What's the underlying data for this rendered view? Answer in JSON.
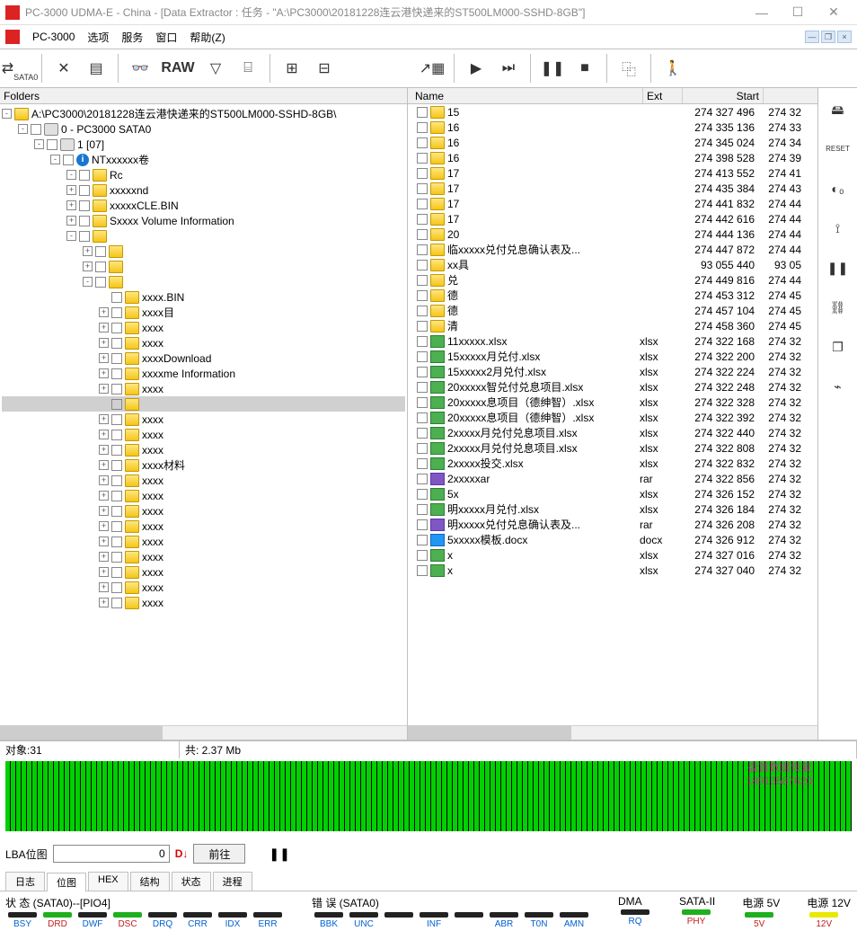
{
  "window": {
    "title": "PC-3000 UDMA-E - China - [Data Extractor : 任务 - \"A:\\PC3000\\20181228连云港快递来的ST500LM000-SSHD-8GB\"]"
  },
  "menubar": {
    "app": "PC-3000",
    "items": [
      "选项",
      "服务",
      "窗口",
      "帮助(Z)"
    ]
  },
  "toolbar": {
    "sata_label": "SATA0",
    "raw": "RAW"
  },
  "right_toolbar": {
    "reset": "RESET"
  },
  "left": {
    "header": "Folders",
    "root": "A:\\PC3000\\20181228连云港快递来的ST500LM000-SSHD-8GB\\",
    "node0": "0 - PC3000 SATA0",
    "node1": "1 [07]",
    "nt": "NTxxxxxx卷",
    "items": [
      {
        "t": "Rc",
        "exp": "-",
        "sel": true
      },
      {
        "t": "xxxxxnd",
        "exp": "+"
      },
      {
        "t": "xxxxxCLE.BIN",
        "exp": "+"
      },
      {
        "t": "Sxxxx Volume Information",
        "exp": "+"
      },
      {
        "t": "",
        "exp": "-"
      },
      {
        "t": "",
        "exp": "+",
        "ind": 1
      },
      {
        "t": "",
        "exp": "+",
        "ind": 1
      },
      {
        "t": "",
        "exp": "-",
        "ind": 1
      },
      {
        "t": "xxxx.BIN",
        "exp": "",
        "ind": 2
      },
      {
        "t": "xxxx目",
        "exp": "+",
        "ind": 2
      },
      {
        "t": "xxxx",
        "exp": "+",
        "ind": 2
      },
      {
        "t": "xxxx",
        "exp": "+",
        "ind": 2
      },
      {
        "t": "xxxxDownload",
        "exp": "+",
        "ind": 2
      },
      {
        "t": "xxxxme Information",
        "exp": "+",
        "ind": 2
      },
      {
        "t": "xxxx",
        "exp": "+",
        "ind": 2
      },
      {
        "t": "",
        "exp": "",
        "ind": 2,
        "hl": true
      },
      {
        "t": "xxxx",
        "exp": "+",
        "ind": 2
      },
      {
        "t": "xxxx",
        "exp": "+",
        "ind": 2
      },
      {
        "t": "xxxx",
        "exp": "+",
        "ind": 2
      },
      {
        "t": "xxxx材料",
        "exp": "+",
        "ind": 2
      },
      {
        "t": "xxxx",
        "exp": "+",
        "ind": 2
      },
      {
        "t": "xxxx",
        "exp": "+",
        "ind": 2
      },
      {
        "t": "xxxx",
        "exp": "+",
        "ind": 2
      },
      {
        "t": "xxxx",
        "exp": "+",
        "ind": 2
      },
      {
        "t": "xxxx",
        "exp": "+",
        "ind": 2
      },
      {
        "t": "xxxx",
        "exp": "+",
        "ind": 2
      },
      {
        "t": "xxxx",
        "exp": "+",
        "ind": 2
      },
      {
        "t": "xxxx",
        "exp": "+",
        "ind": 2
      },
      {
        "t": "xxxx",
        "exp": "+",
        "ind": 2
      }
    ]
  },
  "right": {
    "cols": {
      "name": "Name",
      "ext": "Ext",
      "start": "Start"
    },
    "rows": [
      {
        "icon": "f",
        "n": "15",
        "ext": "",
        "s": "274 327 496",
        "e": "274 32"
      },
      {
        "icon": "f",
        "n": "16",
        "ext": "",
        "s": "274 335 136",
        "e": "274 33"
      },
      {
        "icon": "f",
        "n": "16",
        "ext": "",
        "s": "274 345 024",
        "e": "274 34"
      },
      {
        "icon": "f",
        "n": "16",
        "ext": "",
        "s": "274 398 528",
        "e": "274 39"
      },
      {
        "icon": "f",
        "n": "17",
        "ext": "",
        "s": "274 413 552",
        "e": "274 41"
      },
      {
        "icon": "f",
        "n": "17",
        "ext": "",
        "s": "274 435 384",
        "e": "274 43"
      },
      {
        "icon": "f",
        "n": "17",
        "ext": "",
        "s": "274 441 832",
        "e": "274 44"
      },
      {
        "icon": "f",
        "n": "17",
        "ext": "",
        "s": "274 442 616",
        "e": "274 44"
      },
      {
        "icon": "f",
        "n": "20",
        "ext": "",
        "s": "274 444 136",
        "e": "274 44"
      },
      {
        "icon": "f",
        "n": "临xxxxx兑付兑息确认表及...",
        "ext": "",
        "s": "274 447 872",
        "e": "274 44"
      },
      {
        "icon": "f",
        "n": "xx具",
        "ext": "",
        "s": "93 055 440",
        "e": "93 05"
      },
      {
        "icon": "f",
        "n": "兑",
        "ext": "",
        "s": "274 449 816",
        "e": "274 44"
      },
      {
        "icon": "f",
        "n": "德",
        "ext": "",
        "s": "274 453 312",
        "e": "274 45"
      },
      {
        "icon": "f",
        "n": "德",
        "ext": "",
        "s": "274 457 104",
        "e": "274 45"
      },
      {
        "icon": "f",
        "n": "清",
        "ext": "",
        "s": "274 458 360",
        "e": "274 45"
      },
      {
        "icon": "x",
        "n": "11xxxxx.xlsx",
        "ext": "xlsx",
        "s": "274 322 168",
        "e": "274 32"
      },
      {
        "icon": "x",
        "n": "15xxxxx月兑付.xlsx",
        "ext": "xlsx",
        "s": "274 322 200",
        "e": "274 32"
      },
      {
        "icon": "x",
        "n": "15xxxxx2月兑付.xlsx",
        "ext": "xlsx",
        "s": "274 322 224",
        "e": "274 32"
      },
      {
        "icon": "x",
        "n": "20xxxxx智兑付兑息项目.xlsx",
        "ext": "xlsx",
        "s": "274 322 248",
        "e": "274 32"
      },
      {
        "icon": "x",
        "n": "20xxxxx息项目（德绅智）.xlsx",
        "ext": "xlsx",
        "s": "274 322 328",
        "e": "274 32"
      },
      {
        "icon": "x",
        "n": "20xxxxx息项目（德绅智）.xlsx",
        "ext": "xlsx",
        "s": "274 322 392",
        "e": "274 32"
      },
      {
        "icon": "x",
        "n": "2xxxxx月兑付兑息项目.xlsx",
        "ext": "xlsx",
        "s": "274 322 440",
        "e": "274 32"
      },
      {
        "icon": "x",
        "n": "2xxxxx月兑付兑息项目.xlsx",
        "ext": "xlsx",
        "s": "274 322 808",
        "e": "274 32"
      },
      {
        "icon": "x",
        "n": "2xxxxx投交.xlsx",
        "ext": "xlsx",
        "s": "274 322 832",
        "e": "274 32"
      },
      {
        "icon": "r",
        "n": "2xxxxxar",
        "ext": "rar",
        "s": "274 322 856",
        "e": "274 32"
      },
      {
        "icon": "x",
        "n": "5x",
        "ext": "xlsx",
        "s": "274 326 152",
        "e": "274 32"
      },
      {
        "icon": "x",
        "n": "明xxxxx月兑付.xlsx",
        "ext": "xlsx",
        "s": "274 326 184",
        "e": "274 32"
      },
      {
        "icon": "r",
        "n": "明xxxxx兑付兑息确认表及...",
        "ext": "rar",
        "s": "274 326 208",
        "e": "274 32"
      },
      {
        "icon": "w",
        "n": "5xxxxx模板.docx",
        "ext": "docx",
        "s": "274 326 912",
        "e": "274 32"
      },
      {
        "icon": "x",
        "n": "x",
        "ext": "xlsx",
        "s": "274 327 016",
        "e": "274 32"
      },
      {
        "icon": "x",
        "n": "x",
        "ext": "xlsx",
        "s": "274 327 040",
        "e": "274 32"
      }
    ]
  },
  "status": {
    "objects": "对象:31",
    "total": "共:  2.37 Mb"
  },
  "lba": {
    "label": "LBA位图",
    "value": "0",
    "go": "前往",
    "stop_icon": "D↓"
  },
  "tabs": [
    "日志",
    "位图",
    "HEX",
    "结构",
    "状态",
    "进程"
  ],
  "hw": {
    "state_label": "状 态 (SATA0)--[PIO4]",
    "state": [
      {
        "l": "BSY",
        "c": "blue",
        "on": false
      },
      {
        "l": "DRD",
        "c": "red",
        "on": true
      },
      {
        "l": "DWF",
        "c": "blue",
        "on": false
      },
      {
        "l": "DSC",
        "c": "red",
        "on": true
      },
      {
        "l": "DRQ",
        "c": "blue",
        "on": false
      },
      {
        "l": "CRR",
        "c": "blue",
        "on": false
      },
      {
        "l": "IDX",
        "c": "blue",
        "on": false
      },
      {
        "l": "ERR",
        "c": "blue",
        "on": false
      }
    ],
    "err_label": "错 误 (SATA0)",
    "err": [
      {
        "l": "BBK",
        "c": "blue"
      },
      {
        "l": "UNC",
        "c": "blue"
      },
      {
        "l": "",
        "c": ""
      },
      {
        "l": "INF",
        "c": "blue"
      },
      {
        "l": "",
        "c": ""
      },
      {
        "l": "ABR",
        "c": "blue"
      },
      {
        "l": "T0N",
        "c": "blue"
      },
      {
        "l": "AMN",
        "c": "blue"
      }
    ],
    "dma_label": "DMA",
    "dma": [
      {
        "l": "RQ",
        "c": "blue"
      }
    ],
    "sata_label": "SATA-II",
    "sata": [
      {
        "l": "PHY",
        "c": "red",
        "on": true
      }
    ],
    "p5_label": "电源 5V",
    "p5": [
      {
        "l": "5V",
        "c": "red",
        "on": true
      }
    ],
    "p12_label": "电源 12V",
    "p12": [
      {
        "l": "12V",
        "c": "red",
        "on": "y"
      }
    ]
  },
  "watermark": {
    "l1": "盘首数据恢复",
    "l2": "18913587620"
  }
}
